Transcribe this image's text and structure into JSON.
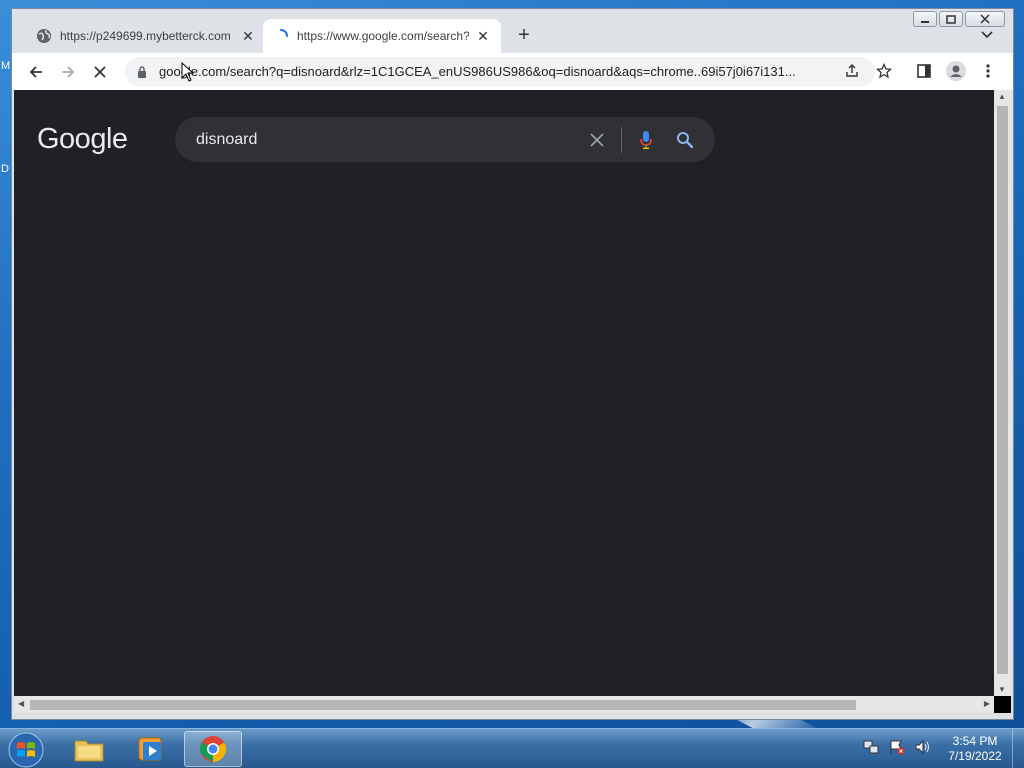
{
  "desktop": {
    "labels": [
      "M",
      "D"
    ]
  },
  "browser": {
    "tabs": [
      {
        "title": "https://p249699.mybetterck.com",
        "icon": "globe-icon",
        "active": false
      },
      {
        "title": "https://www.google.com/search?q",
        "icon": "loading-spinner-icon",
        "active": true
      }
    ],
    "new_tab_label": "+",
    "close_symbol": "✕",
    "address_bar": {
      "url": "google.com/search?q=disnoard&rlz=1C1GCEA_enUS986US986&oq=disnoard&aqs=chrome..69i57j0i67i131..."
    }
  },
  "page": {
    "logo_text": "Google",
    "search": {
      "query": "disnoard"
    }
  },
  "taskbar": {
    "clock_time": "3:54 PM",
    "clock_date": "7/19/2022",
    "pinned": [
      "windows-explorer",
      "media-player",
      "chrome"
    ]
  },
  "colors": {
    "page_bg": "#202124",
    "searchbox_bg": "#303134",
    "accent_blue": "#8ab4f8"
  }
}
